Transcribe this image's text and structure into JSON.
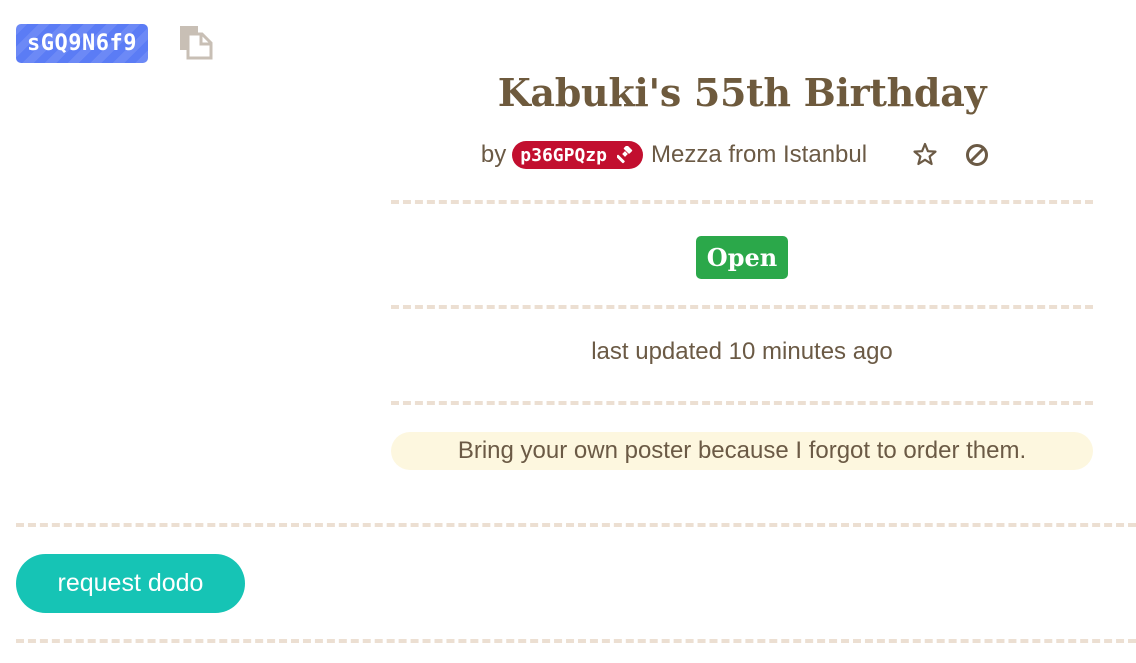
{
  "island": {
    "code": "sGQ9N6f9",
    "copy_icon": "copy-icon"
  },
  "event": {
    "title": "Kabuki's 55th Birthday",
    "by_label": "by",
    "host_badge": "p36GPQzp",
    "host_badge_icon": "gavel-icon",
    "host_name": "Mezza from Istanbul",
    "star_icon": "star-outline-icon",
    "block_icon": "block-icon",
    "status": "Open",
    "last_updated": "last updated 10 minutes ago",
    "note": "Bring your own poster because I forgot to order them."
  },
  "actions": {
    "request_label": "request dodo"
  },
  "colors": {
    "code_badge": "#5b7cf5",
    "host_badge": "#c20f2f",
    "status_open": "#2ba84a",
    "request_button": "#16c4b5",
    "note_bg": "#fdf7df",
    "dash": "#ecdfd2",
    "text": "#6b5a45"
  }
}
